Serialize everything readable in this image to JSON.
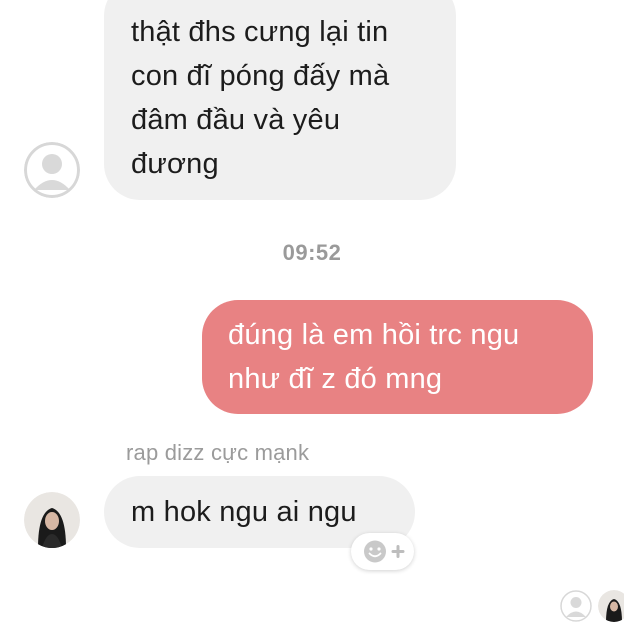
{
  "conversation": {
    "messages": [
      {
        "direction": "incoming",
        "lines": [
          "thật đhs cưng lại tin",
          "con đĩ póng đấy mà",
          "đâm đầu và yêu",
          "đương"
        ]
      },
      {
        "direction": "outgoing",
        "lines": [
          "đúng là em hồi trc ngu",
          "như đĩ z đó mng"
        ]
      },
      {
        "direction": "incoming",
        "sender": "rap dizz cực mạnk",
        "lines": [
          "m hok ngu ai ngu"
        ]
      }
    ],
    "timestamp": "09:52"
  },
  "icons": {
    "default_avatar": "default-avatar-icon",
    "user_avatar": "user-avatar",
    "reaction": "add-reaction-icon"
  },
  "colors": {
    "incoming_bubble": "#f0f0f0",
    "outgoing_bubble": "#e88283",
    "meta_text": "#9a9a9a"
  }
}
